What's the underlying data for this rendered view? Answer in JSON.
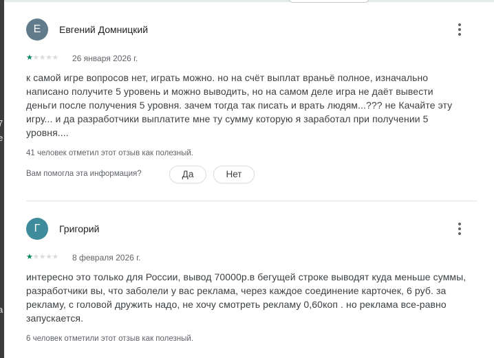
{
  "background_edge_chars": [
    "7",
    "е",
    "а"
  ],
  "reviews": [
    {
      "avatar_letter": "Е",
      "avatar_color": "#617b8c",
      "author": "Евгений Домницкий",
      "rating": 1,
      "stars": [
        1,
        0,
        0,
        0,
        0
      ],
      "date": "26 января 2026 г.",
      "text": "к самой игре вопросов нет, играть можно. но на счёт выплат враньё полное, изначально написано получите 5 уровень и можно выводить, но на самом деле игра не даёт вывести деньги после получения 5 уровня. зачем тогда так писать и врать людям...??? не Качайте эту игру... и да разработчики выплатите мне ту сумму которую я заработал при получении 5 уровня....",
      "helpful": "41 человек отметил этот отзыв как полезный.",
      "question": "Вам помогла эта информация?",
      "yes_label": "Да",
      "no_label": "Нет"
    },
    {
      "avatar_letter": "Г",
      "avatar_color": "#3e8b9c",
      "author": "Григорий",
      "rating": 1,
      "stars": [
        1,
        0,
        0,
        0,
        0
      ],
      "date": "8 февраля 2026 г.",
      "text": "интересно это только для России, вывод 70000р.в бегущей строке выводят куда меньше суммы, разработчики вы, что заболели у вас реклама, через каждое соединение карточек, 6 руб. за рекламу, с головой дружить надо, не хочу смотреть рекламу 0,60коп . но реклама все-равно запускается.",
      "helpful": "6 человек отметили этот отзыв как полезный."
    }
  ]
}
